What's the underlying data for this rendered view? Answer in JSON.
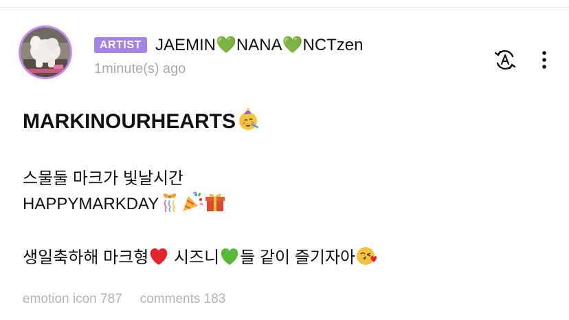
{
  "post": {
    "badge": "ARTIST",
    "author": {
      "name_1": "JAEMIN",
      "name_2": "NANA",
      "name_3": "NCTzen",
      "heart_symbol": "💚"
    },
    "timestamp": "1minute(s) ago",
    "title": "MARKINOURHEARTS",
    "lines": {
      "line_1": "스물둘 마크가 빛날시간",
      "line_2": "HAPPYMARKDAY",
      "line_3a": "생일축하해 마크형",
      "line_3b": " 시즈니",
      "line_3c": "들 같이 즐기자아"
    },
    "stats": {
      "emotion": "emotion icon 787",
      "comments": "comments 183"
    }
  },
  "icons": {
    "translate": "translate-icon",
    "more": "more-vertical-icon",
    "green_heart": "green-heart-icon",
    "red_heart": "red-heart-icon",
    "party_face": "partying-face-icon",
    "ribbon": "ribbon-icon",
    "party_popper": "party-popper-icon",
    "gift": "gift-icon",
    "kiss_face": "face-blowing-kiss-icon"
  },
  "colors": {
    "badge_bg": "#a583e8",
    "avatar_ring": "#c58bf2",
    "muted_text": "#a9a9a9",
    "green_heart": "#58b83a",
    "red_heart": "#e3242b"
  }
}
